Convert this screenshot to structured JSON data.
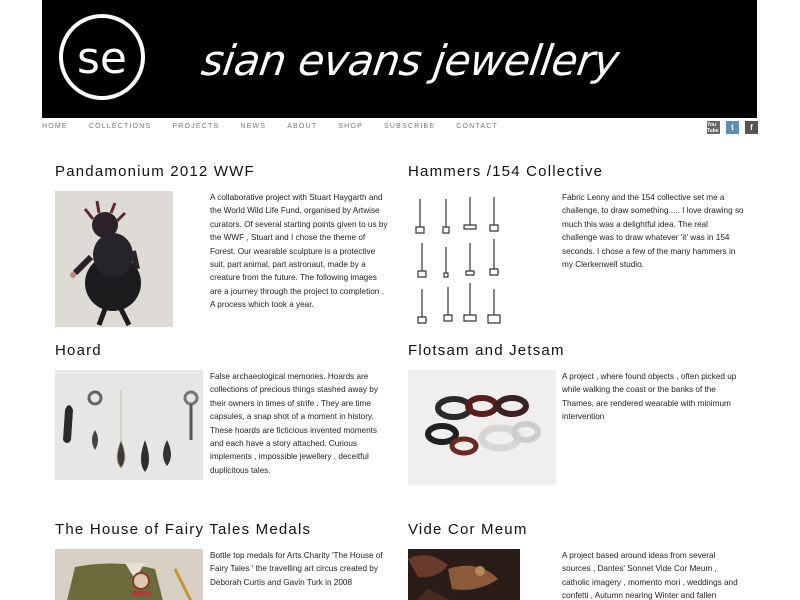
{
  "header": {
    "brand": "sian evans jewellery",
    "logo_text": "se"
  },
  "nav": {
    "items": [
      "HOME",
      "COLLECTIONS",
      "PROJECTS",
      "NEWS",
      "ABOUT",
      "SHOP",
      "SUBSCRIBE",
      "CONTACT"
    ]
  },
  "social": {
    "icons": [
      "youtube-icon",
      "twitter-icon",
      "facebook-icon"
    ],
    "youtube_label": "You Tube",
    "twitter_label": "t",
    "facebook_label": "f"
  },
  "projects": [
    {
      "title": "Pandamonium 2012 WWF",
      "description": "A collaborative project with Stuart Haygarth and the World Wild Life Fund, organised by Artwise curators. Of several starting points given to us by the WWF , Stuart and I chose the theme of Forest. Our wearable sculpture is a protective suit, part animal, part astronaut, made by a creature from the future. The following images are a journey through the project to completion . A process which took a year."
    },
    {
      "title": "Hammers /154 Collective",
      "description": "Fabric Lenny and the 154 collective set me a challenge, to draw something..... I love drawing so much this was a delightful idea. The real challenge was to draw whatever 'it' was in 154 seconds. I chose a few of the many hammers in my Clerkenwell studio."
    },
    {
      "title": "Hoard",
      "description": "False archaeological memories. Hoards are collections of precious things stashed away by their owners in times of strife . They are time capsules, a snap shot of a moment in history. These hoards are ficticious invented moments and each have a story attached. Curious implements , impossible jewellery , deceitful duplicitous tales."
    },
    {
      "title": "Flotsam and Jetsam",
      "description": "A project , where found objects , often picked up while walking the coast or the banks of the Thames, are rendered wearable with minimum intervention"
    },
    {
      "title": "The House of Fairy Tales Medals",
      "description": "Bottle top medals for Arts Charity 'The House of Fairy Tales ' the travelling art circus created by Deborah Curtis and Gavin Turk in 2008"
    },
    {
      "title": "Vide Cor Meum",
      "description": "A project based around ideas from several sources , Dantes' Sonnet Vide Cor Meum , catholic imagery , momento mori , weddings and confetti , Autumn nearing Winter and fallen leaves. St Michaels"
    }
  ]
}
